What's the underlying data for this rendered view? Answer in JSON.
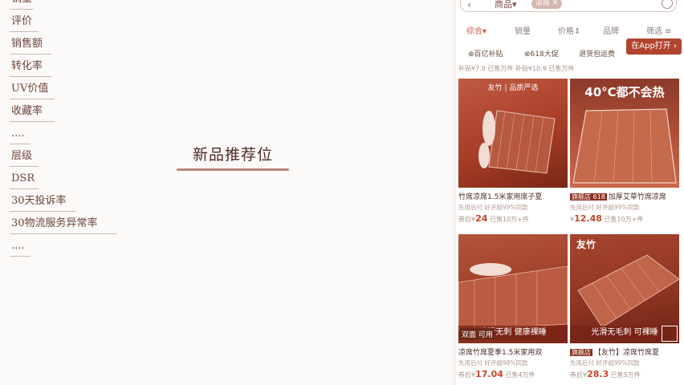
{
  "left_metrics": [
    "销量",
    "评价",
    "销售额",
    "转化率",
    "UV价值",
    "收藏率",
    "....",
    "层级",
    "DSR",
    "30天投诉率",
    "30物流服务异常率",
    "...."
  ],
  "center": {
    "title": "新品推荐位"
  },
  "phone": {
    "search": {
      "scope": "商品",
      "tag": "凉席"
    },
    "sort_tabs": [
      "综合",
      "销量",
      "价格",
      "品牌",
      "筛选"
    ],
    "open_app": "在App打开",
    "filters": [
      "百亿补贴",
      "618大促",
      "退货包运费"
    ],
    "prev_row_text": "补贴¥7.9 已售万件   补贴¥10.9 已售万件",
    "products": [
      {
        "img_label": "友竹 | 品质严选",
        "img_band": "",
        "title": "竹席凉席1.5米家用席子夏",
        "badge": "",
        "sub": "先用后付 好评超99%同款",
        "price_prefix": "券后¥",
        "price": "24",
        "sold": "已售10万+件"
      },
      {
        "img_label": "40°C都不会热",
        "img_band": "",
        "title": "加厚艾草竹席凉席",
        "badge": "旗舰店 618",
        "sub": "先用后付 好评超99%同款",
        "price_prefix": "¥",
        "price": "12.48",
        "sold": "已售10万+件"
      },
      {
        "img_label": "",
        "img_band": "凉滑无刺 健康裸睡",
        "stack": "双面 可用",
        "title": "凉席竹席夏季1.5米家用双",
        "badge": "",
        "sub": "先用后付 好评超98%同款",
        "price_prefix": "券后¥",
        "price": "17.04",
        "sold": "已售4万件"
      },
      {
        "img_label": "友竹",
        "img_band": "光滑无毛刺 可裸睡",
        "title": "【友竹】凉席竹席夏",
        "badge": "旗舰店",
        "sub": "先用后付 好评超99%同款",
        "price_prefix": "券后¥",
        "price": "28.3",
        "sold": "已售5万件"
      }
    ]
  }
}
